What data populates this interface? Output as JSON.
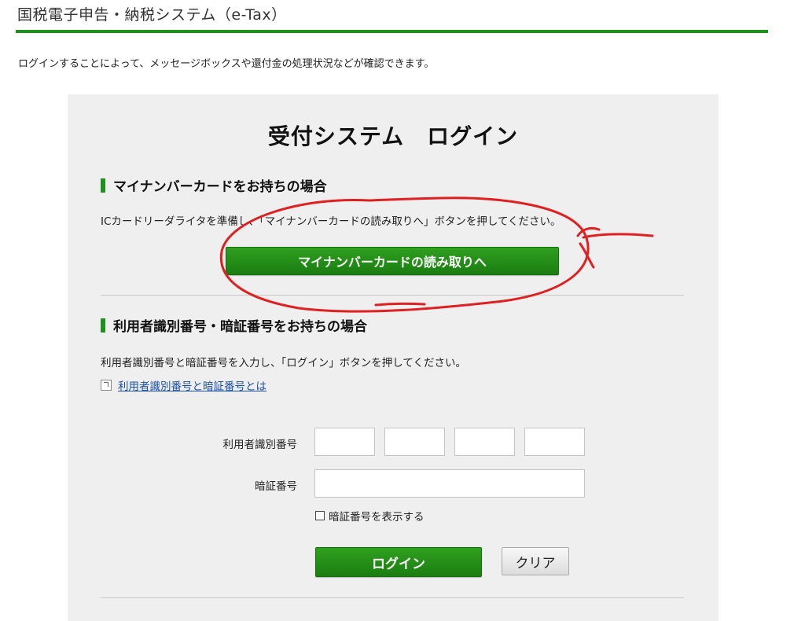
{
  "header": {
    "site_title": "国税電子申告・納税システム（e-Tax）"
  },
  "intro_text": "ログインすることによって、メッセージボックスや還付金の処理状況などが確認できます。",
  "login_panel": {
    "title": "受付システム　ログイン",
    "mynumber_section": {
      "heading": "マイナンバーカードをお持ちの場合",
      "description": "ICカードリーダライタを準備し、「マイナンバーカードの読み取りへ」ボタンを押してください。",
      "button_label": "マイナンバーカードの読み取りへ"
    },
    "id_password_section": {
      "heading": "利用者識別番号・暗証番号をお持ちの場合",
      "description": "利用者識別番号と暗証番号を入力し、「ログイン」ボタンを押してください。",
      "help_link": "利用者識別番号と暗証番号とは",
      "user_id_label": "利用者識別番号",
      "user_id_fields": [
        "",
        "",
        "",
        ""
      ],
      "password_label": "暗証番号",
      "password_value": "",
      "show_password_label": "暗証番号を表示する",
      "show_password_checked": false,
      "login_button": "ログイン",
      "clear_button": "クリア"
    }
  },
  "colors": {
    "accent_green": "#1f8f1f",
    "panel_background": "#efefef",
    "link_blue": "#1a4fa8",
    "annotation_red": "#e02020"
  }
}
